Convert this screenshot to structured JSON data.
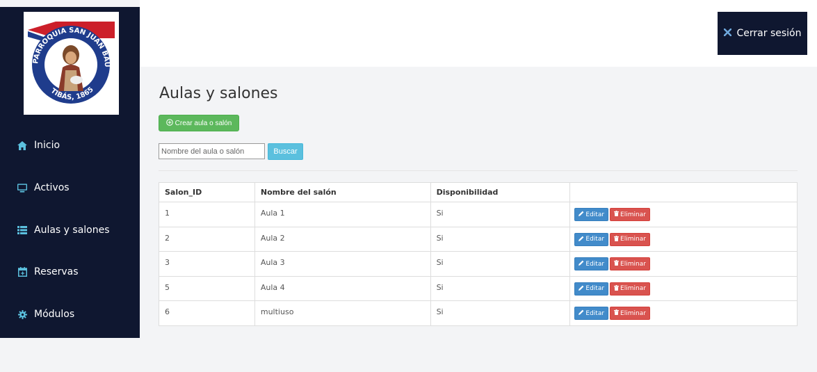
{
  "logo": {
    "top_text": "PARROQUIA SAN JUAN BAUTISTA",
    "bottom_text": "TIBÁS, 1865"
  },
  "sidebar": {
    "items": [
      {
        "label": "Inicio",
        "icon": "home-icon"
      },
      {
        "label": "Activos",
        "icon": "monitor-icon"
      },
      {
        "label": "Aulas y salones",
        "icon": "list-icon"
      },
      {
        "label": "Reservas",
        "icon": "calendar-plus-icon"
      },
      {
        "label": "Módulos",
        "icon": "gear-icon"
      }
    ]
  },
  "header": {
    "logout_label": "Cerrar sesión"
  },
  "main": {
    "title": "Aulas y salones",
    "create_label": "Crear aula o salón",
    "search_placeholder": "Nombre del aula o salón",
    "search_button": "Buscar"
  },
  "table": {
    "headers": [
      "Salon_ID",
      "Nombre del salón",
      "Disponibilidad",
      ""
    ],
    "rows": [
      [
        "1",
        "Aula 1",
        "Si"
      ],
      [
        "2",
        "Aula 2",
        "Si"
      ],
      [
        "3",
        "Aula 3",
        "Si"
      ],
      [
        "5",
        "Aula 4",
        "Si"
      ],
      [
        "6",
        "multiuso",
        "Si"
      ]
    ],
    "edit_label": "Editar",
    "delete_label": "Eliminar"
  },
  "colors": {
    "sidebar": "#0f1730",
    "success": "#5cb85c",
    "info": "#5bc0de",
    "primary": "#428bca",
    "danger": "#d9534f"
  }
}
